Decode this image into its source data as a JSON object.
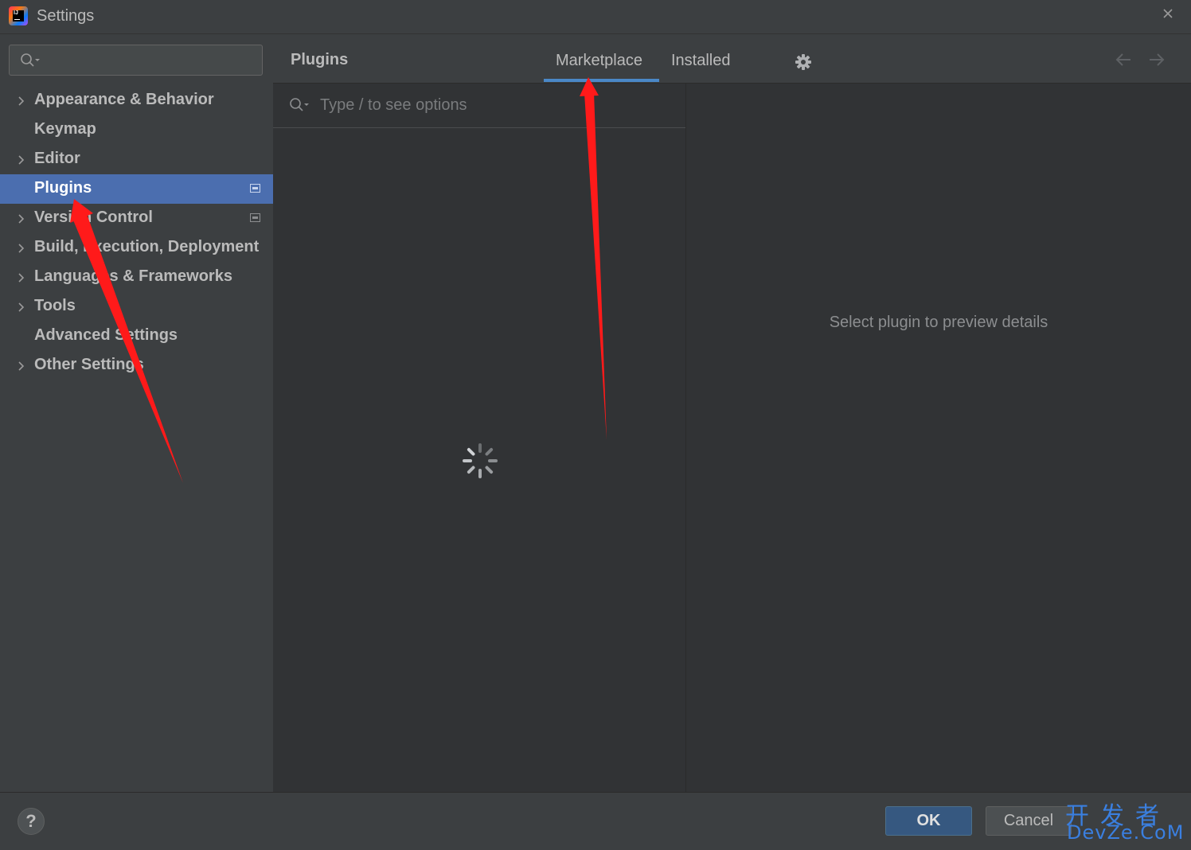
{
  "window": {
    "title": "Settings",
    "logo_icon": "intellij-idea-icon",
    "close_icon": "close-icon"
  },
  "sidebar": {
    "search": {
      "value": "",
      "icon": "search-icon"
    },
    "items": [
      {
        "label": "Appearance & Behavior",
        "expandable": true,
        "selected": false,
        "badge": false
      },
      {
        "label": "Keymap",
        "expandable": false,
        "selected": false,
        "badge": false
      },
      {
        "label": "Editor",
        "expandable": true,
        "selected": false,
        "badge": false
      },
      {
        "label": "Plugins",
        "expandable": false,
        "selected": true,
        "badge": true
      },
      {
        "label": "Version Control",
        "expandable": true,
        "selected": false,
        "badge": true
      },
      {
        "label": "Build, Execution, Deployment",
        "expandable": true,
        "selected": false,
        "badge": false
      },
      {
        "label": "Languages & Frameworks",
        "expandable": true,
        "selected": false,
        "badge": false
      },
      {
        "label": "Tools",
        "expandable": true,
        "selected": false,
        "badge": false
      },
      {
        "label": "Advanced Settings",
        "expandable": false,
        "selected": false,
        "badge": false
      },
      {
        "label": "Other Settings",
        "expandable": true,
        "selected": false,
        "badge": false
      }
    ]
  },
  "header": {
    "title": "Plugins",
    "tabs": [
      {
        "label": "Marketplace",
        "active": true
      },
      {
        "label": "Installed",
        "active": false
      }
    ],
    "settings_icon": "gear-icon",
    "back_icon": "arrow-left-icon",
    "forward_icon": "arrow-right-icon"
  },
  "plugin_list": {
    "search_placeholder": "Type / to see options",
    "loading_icon": "loading-spinner-icon"
  },
  "details": {
    "empty_text": "Select plugin to preview details"
  },
  "footer": {
    "help_label": "?",
    "ok_label": "OK",
    "cancel_label": "Cancel"
  },
  "watermark": {
    "line1": "开发者",
    "line2": "DevZe.CoM"
  },
  "colors": {
    "accent": "#4b6eaf",
    "tab_underline": "#4a88c7",
    "annotation_arrow": "#ff0000",
    "watermark": "#3a7fe0"
  }
}
